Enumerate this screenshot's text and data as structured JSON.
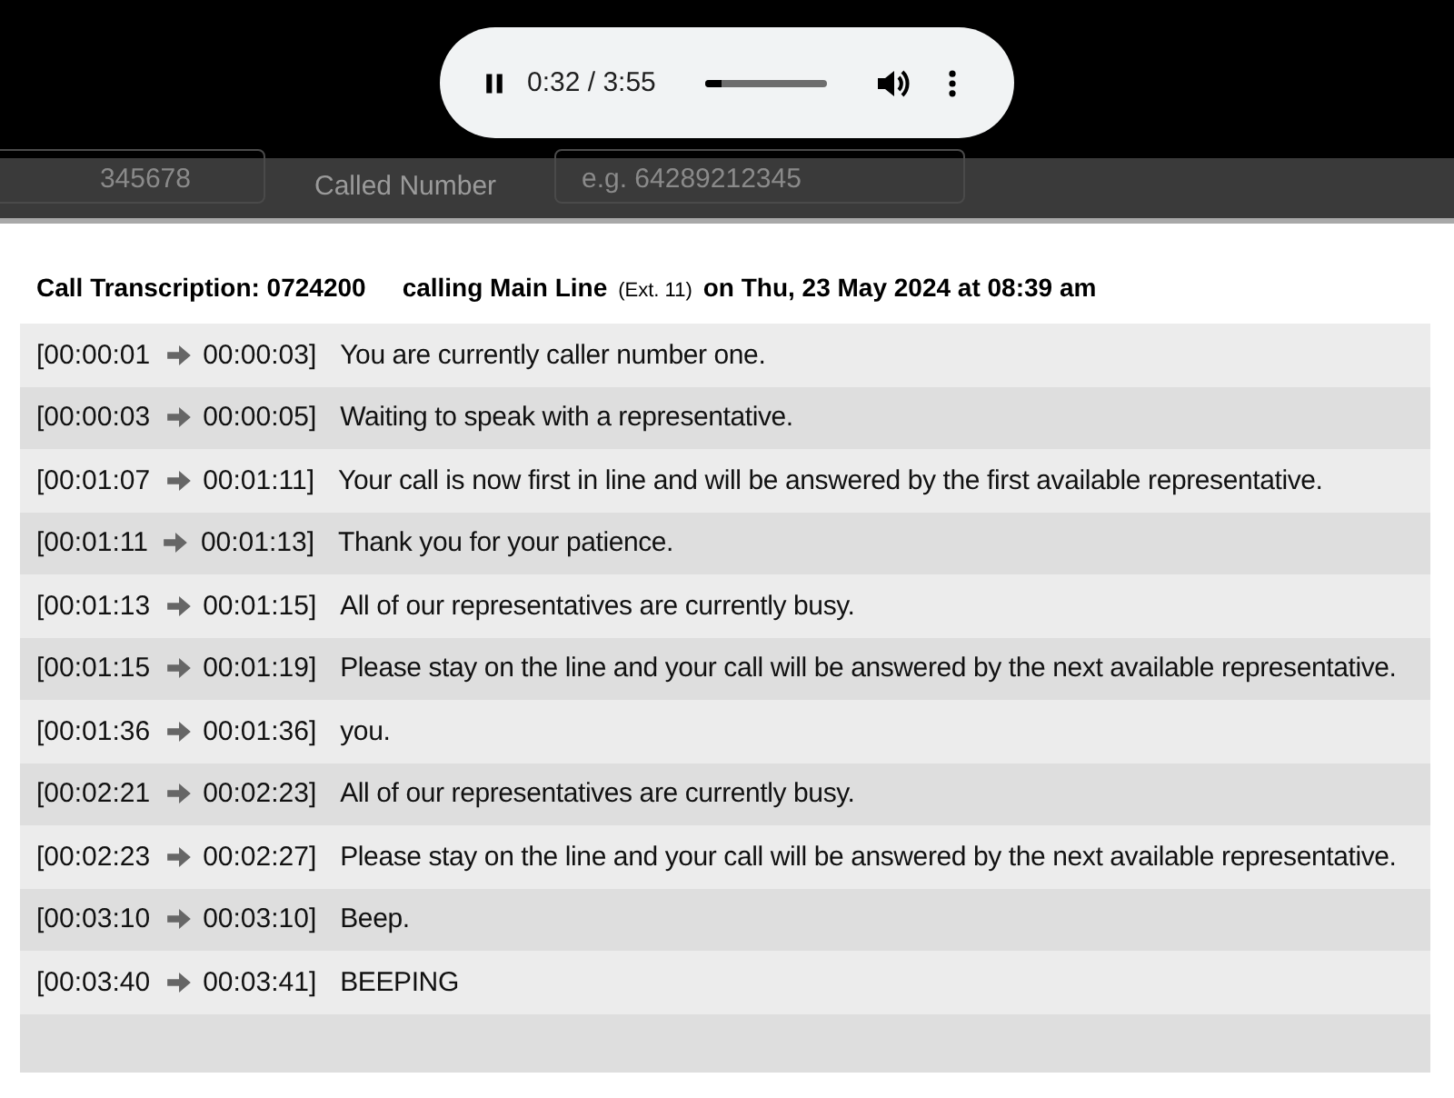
{
  "player": {
    "playing": true,
    "time": "0:32 / 3:55",
    "level": 0.14
  },
  "backdrop": {
    "field_1": {
      "value": "345678"
    },
    "label": "Called Number",
    "field_2": {
      "placeholder": "e.g. 64289212345"
    }
  },
  "header": {
    "caller": "Call Transcription: 0724200",
    "callee": "calling Main Line",
    "extension": "(Ext. 11)",
    "when": "on Thu, 23 May 2024 at 08:39 am"
  },
  "rows": [
    {
      "start": "[00:00:01",
      "end": "00:00:03]",
      "text": "You are currently caller number one."
    },
    {
      "start": "[00:00:03",
      "end": "00:00:05]",
      "text": "Waiting to speak with a representative."
    },
    {
      "start": "[00:01:07",
      "end": "00:01:11]",
      "text": "Your call is now first in line and will be answered by the first available representative."
    },
    {
      "start": "[00:01:11",
      "end": "00:01:13]",
      "text": "Thank you for your patience."
    },
    {
      "start": "[00:01:13",
      "end": "00:01:15]",
      "text": "All of our representatives are currently busy."
    },
    {
      "start": "[00:01:15",
      "end": "00:01:19]",
      "text": "Please stay on the line and your call will be answered by the next available representative."
    },
    {
      "start": "[00:01:36",
      "end": "00:01:36]",
      "text": "you."
    },
    {
      "start": "[00:02:21",
      "end": "00:02:23]",
      "text": "All of our representatives are currently busy."
    },
    {
      "start": "[00:02:23",
      "end": "00:02:27]",
      "text": "Please stay on the line and your call will be answered by the next available representative."
    },
    {
      "start": "[00:03:10",
      "end": "00:03:10]",
      "text": "Beep."
    },
    {
      "start": "[00:03:40",
      "end": "00:03:41]",
      "text": "BEEPING"
    }
  ]
}
